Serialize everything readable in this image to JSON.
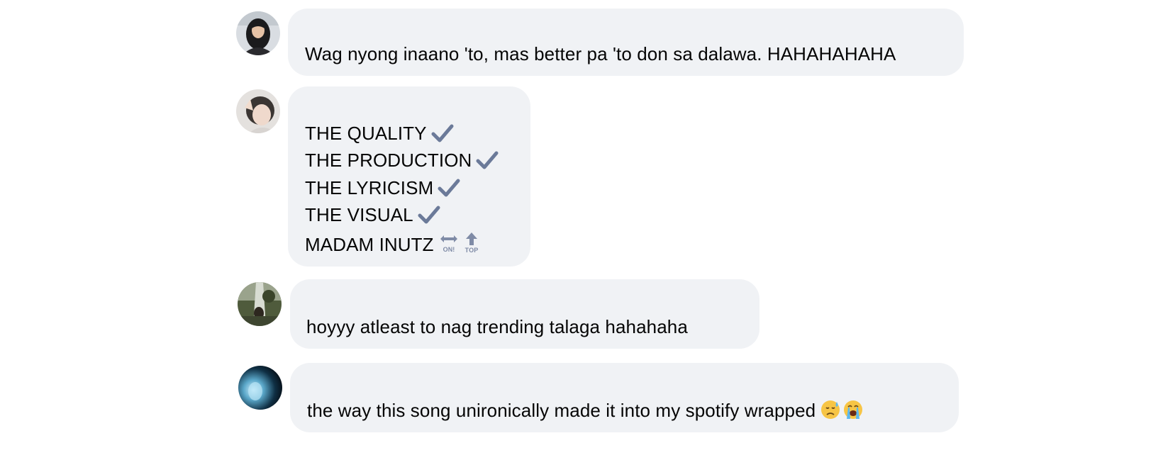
{
  "comments": [
    {
      "avatar": "user-avatar-woman-dark-hair",
      "lines": [
        "Wag nyong inaano 'to, mas better pa 'to don sa dalawa. HAHAHAHAHA"
      ]
    },
    {
      "avatar": "user-avatar-peace-sign",
      "lines": [
        {
          "text": "THE QUALITY",
          "emoji": "check-mark-icon"
        },
        {
          "text": "THE PRODUCTION",
          "emoji": "check-mark-icon"
        },
        {
          "text": "THE LYRICISM",
          "emoji": "check-mark-icon"
        },
        {
          "text": "THE VISUAL",
          "emoji": "check-mark-icon"
        },
        {
          "text": "MADAM INUTZ",
          "emoji": "on-arrow-top-arrow-icons",
          "emoji_labels": [
            "ON!",
            "TOP"
          ]
        }
      ]
    },
    {
      "avatar": "user-avatar-waterfall",
      "lines": [
        "hoyyy atleast to nag trending talaga hahahaha"
      ]
    },
    {
      "avatar": "user-avatar-blue-glow",
      "lines": [
        "the way this song unironically made it into my spotify wrapped"
      ],
      "emojis": [
        "downcast-sweat-face-emoji",
        "loudly-crying-face-emoji"
      ]
    }
  ],
  "colors": {
    "bubble_bg": "#f0f2f5",
    "text": "#050505",
    "checkmark": "#6b7a99"
  }
}
